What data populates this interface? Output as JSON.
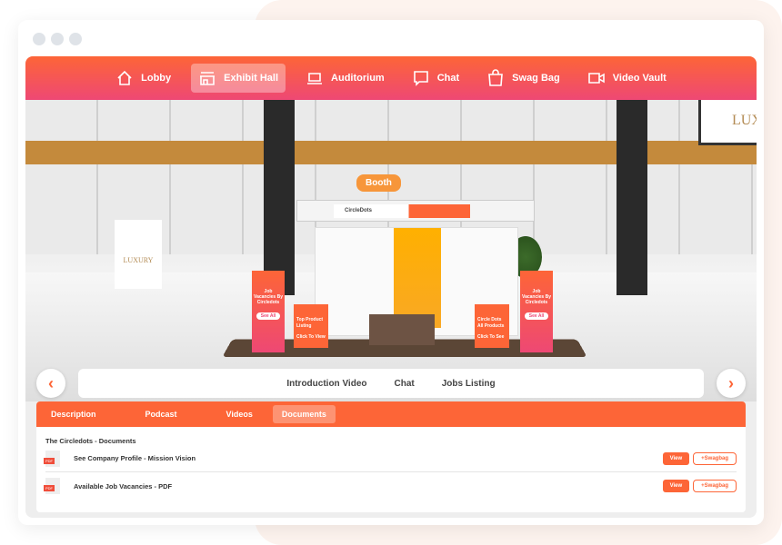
{
  "nav": {
    "items": [
      {
        "label": "Lobby",
        "icon": "home-icon",
        "active": false
      },
      {
        "label": "Exhibit Hall",
        "icon": "store-icon",
        "active": true
      },
      {
        "label": "Auditorium",
        "icon": "laptop-icon",
        "active": false
      },
      {
        "label": "Chat",
        "icon": "chat-bubble-icon",
        "active": false
      },
      {
        "label": "Swag Bag",
        "icon": "shopping-bag-icon",
        "active": false
      },
      {
        "label": "Video Vault",
        "icon": "video-camera-icon",
        "active": false
      }
    ]
  },
  "scene": {
    "booth_label": "Booth",
    "brand_name": "CircleDots",
    "left_sign": "LUXURY",
    "right_sign": "LUX",
    "banner_outer": "Job Vacancies By Circledots",
    "banner_outer_button": "See All",
    "banner_left_inner": "Top Product Listing",
    "banner_left_inner_cta": "Click To View",
    "banner_right_inner": "Circle Dots All Products",
    "banner_right_inner_cta": "Click To See"
  },
  "booth_tabs": [
    "Introduction Video",
    "Chat",
    "Jobs Listing"
  ],
  "panel": {
    "tabs": [
      {
        "label": "Description",
        "active": false
      },
      {
        "label": "Podcast",
        "active": false
      },
      {
        "label": "Videos",
        "active": false
      },
      {
        "label": "Documents",
        "active": true
      }
    ],
    "title": "The Circledots - Documents",
    "documents": [
      {
        "name": "See Company Profile - Mission Vision",
        "type": "PDF"
      },
      {
        "name": "Available Job Vacancies - PDF",
        "type": "PDF"
      }
    ],
    "view_label": "View",
    "swagbag_label": "+Swagbag"
  },
  "colors": {
    "accent": "#fd6537",
    "accent2": "#ee4874"
  }
}
